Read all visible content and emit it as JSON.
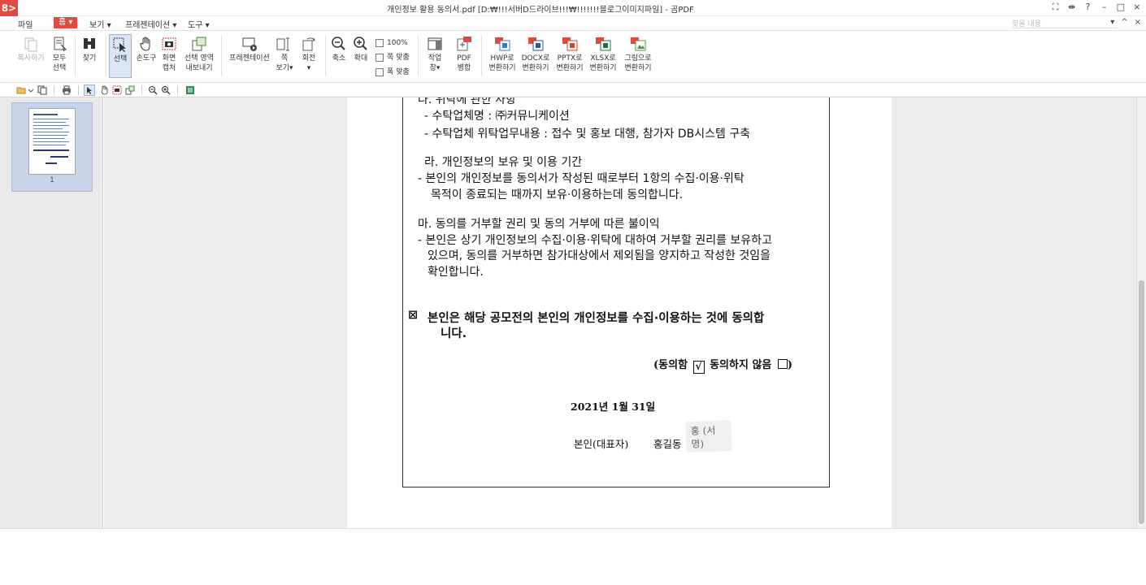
{
  "titlebar": {
    "logo": "8>",
    "title": "개인정보 활용 동의서.pdf [D:₩!!!서버D드라이브!!!₩!!!!!!!블로그이미지파일] - 곰PDF",
    "controls": [
      "⛶",
      "⇼",
      "?",
      "–",
      "□",
      "×"
    ]
  },
  "menubar": {
    "file": "파일",
    "home": "홈",
    "view": "보기",
    "presentation": "프레젠테이션",
    "tools": "도구",
    "search_placeholder": "찾을 내용",
    "right_controls": [
      "▾",
      "^",
      "×"
    ]
  },
  "ribbon": {
    "copy": "복사하기",
    "select_all": [
      "모두",
      "선택"
    ],
    "find": "찾기",
    "select": "선택",
    "hand_tool": "손도구",
    "screen_capture": [
      "화면",
      "캡처"
    ],
    "export_region": [
      "선택 영역",
      "내보내기"
    ],
    "presentation": "프레젠테이션",
    "page_view": [
      "쪽",
      "보기▾"
    ],
    "rotate": [
      "회전",
      "▾"
    ],
    "zoom_out": "축소",
    "zoom_in": "확대",
    "zoom_100": "100%",
    "fit_page": "쪽 맞춤",
    "fit_width": "폭 맞춤",
    "work_window": [
      "작업",
      "창▾"
    ],
    "pdf_merge": [
      "PDF",
      "병합"
    ],
    "to_hwp": [
      "HWP로",
      "변환하기"
    ],
    "to_docx": [
      "DOCX로",
      "변환하기"
    ],
    "to_pptx": [
      "PPTX로",
      "변환하기"
    ],
    "to_xlsx": [
      "XLSX로",
      "변환하기"
    ],
    "to_image": [
      "그림으로",
      "변환하기"
    ]
  },
  "thumbnail": {
    "page_number": "1"
  },
  "document": {
    "line_top": "나. 위탁에 관한 사항",
    "consignee_name": "-  수탁업체명 : ㈜커뮤니케이션",
    "consignee_work": "-  수탁업체 위탁업무내용 : 접수 및 홍보 대행, 참가자 DB시스템 구축",
    "section_ra": "라. 개인정보의 보유 및 이용 기간",
    "ra_line1": "-  본인의 개인정보를 동의서가 작성된 때로부터 1항의 수집·이용·위탁",
    "ra_line2": "목적이 종료되는 때까지 보유·이용하는데 동의합니다.",
    "section_ma": "마. 동의를 거부할 권리 및 동의 거부에 따른 불이익",
    "ma_line1": "- 본인은 상기 개인정보의 수집·이용·위탁에 대하여 거부할 권리를 보유하고",
    "ma_line2": "있으며, 동의를 거부하면 참가대상에서 제외됨을 양지하고 작성한 것임을",
    "ma_line3": "확인합니다.",
    "consent_mark": "⊠",
    "consent_line1": "본인은 해당 공모전의 본인의 개인정보를 수집·이용하는 것에    동의합",
    "consent_line2": "니다.",
    "agree_prefix": "(동의함",
    "agree_check": "√",
    "disagree": "동의하지 않음",
    "agree_suffix": ")",
    "date": "2021년  1월  31일",
    "signer_label": "본인(대표자)",
    "signer_name": "홍길동",
    "seal_text_1": "홍",
    "seal_text_2": "(서명)"
  }
}
